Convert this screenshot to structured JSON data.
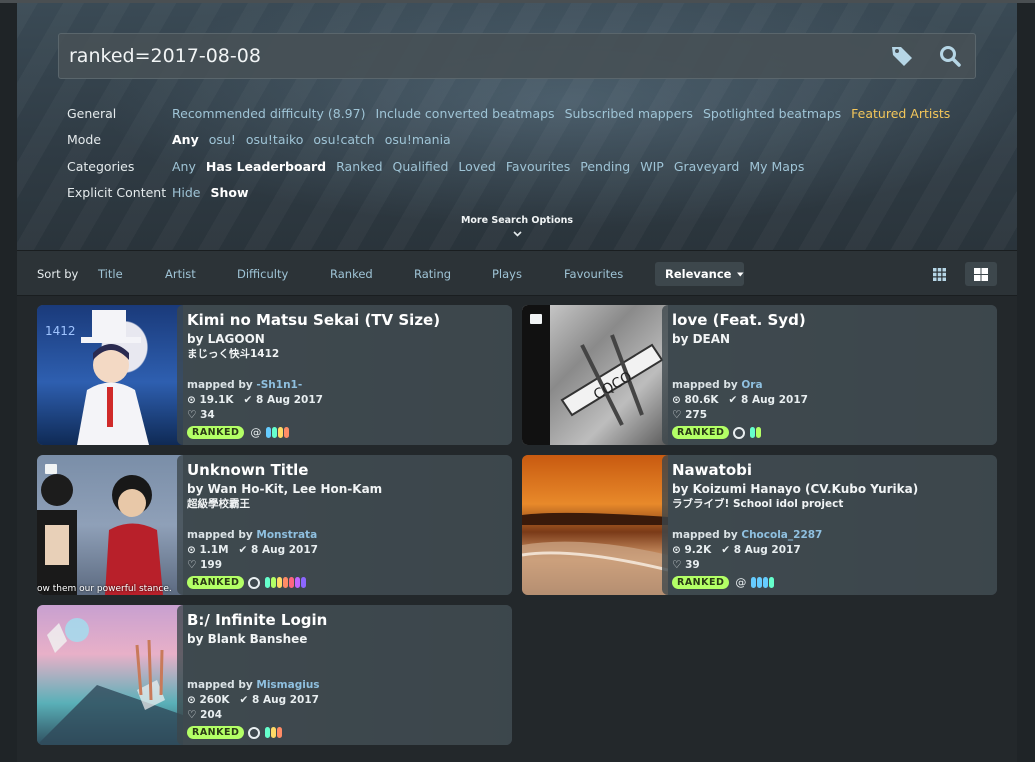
{
  "search": {
    "value": "ranked=2017-08-08"
  },
  "filters": {
    "general": {
      "label": "General",
      "options": [
        "Recommended difficulty (8.97)",
        "Include converted beatmaps",
        "Subscribed mappers",
        "Spotlighted beatmaps",
        "Featured Artists"
      ]
    },
    "mode": {
      "label": "Mode",
      "options": [
        "Any",
        "osu!",
        "osu!taiko",
        "osu!catch",
        "osu!mania"
      ]
    },
    "categories": {
      "label": "Categories",
      "options": [
        "Any",
        "Has Leaderboard",
        "Ranked",
        "Qualified",
        "Loved",
        "Favourites",
        "Pending",
        "WIP",
        "Graveyard",
        "My Maps"
      ]
    },
    "explicit": {
      "label": "Explicit Content",
      "options": [
        "Hide",
        "Show"
      ]
    },
    "more_options": "More Search Options"
  },
  "sort": {
    "label": "Sort by",
    "items": [
      "Title",
      "Artist",
      "Difficulty",
      "Ranked",
      "Rating",
      "Plays",
      "Favourites"
    ],
    "active": "Relevance"
  },
  "cards": [
    {
      "title": "Kimi no Matsu Sekai (TV Size)",
      "artist": "by LAGOON",
      "source": "まじっく快斗1412",
      "mapped_prefix": "mapped by ",
      "mapper": "-Sh1n1-",
      "plays": "19.1K",
      "date": "8 Aug 2017",
      "favs": "34",
      "status": "RANKED",
      "diffs": [
        "#66ccff",
        "#66ffcc",
        "#ffd966",
        "#ff8c66"
      ]
    },
    {
      "title": "love (Feat. Syd)",
      "artist": "by DEAN",
      "source": "",
      "mapped_prefix": "mapped by ",
      "mapper": "Ora",
      "plays": "80.6K",
      "date": "8 Aug 2017",
      "favs": "275",
      "status": "RANKED",
      "diffs": [
        "#66ffcc",
        "#b3ff66"
      ]
    },
    {
      "title": "Unknown Title",
      "artist": "by Wan Ho-Kit, Lee Hon-Kam",
      "source": "超級學校霸王",
      "mapped_prefix": "mapped by ",
      "mapper": "Monstrata",
      "plays": "1.1M",
      "date": "8 Aug 2017",
      "favs": "199",
      "status": "RANKED",
      "diffs": [
        "#66ffcc",
        "#b3ff66",
        "#ffd966",
        "#ff8c66",
        "#ff6680",
        "#c266ff",
        "#8c66ff"
      ],
      "caption": "ow them our powerful stance."
    },
    {
      "title": "Nawatobi",
      "artist": "by Koizumi Hanayo (CV.Kubo Yurika)",
      "source": "ラブライブ! School idol project",
      "mapped_prefix": "mapped by ",
      "mapper": "Chocola_2287",
      "plays": "9.2K",
      "date": "8 Aug 2017",
      "favs": "39",
      "status": "RANKED",
      "diffs": [
        "#66ccff",
        "#66ccff",
        "#66ccff",
        "#66ffcc"
      ]
    },
    {
      "title": "B:/ Infinite Login",
      "artist": "by Blank Banshee",
      "source": "",
      "mapped_prefix": "mapped by ",
      "mapper": "Mismagius",
      "plays": "260K",
      "date": "8 Aug 2017",
      "favs": "204",
      "status": "RANKED",
      "diffs": [
        "#66ffcc",
        "#ffd966",
        "#ff8c66"
      ]
    }
  ]
}
